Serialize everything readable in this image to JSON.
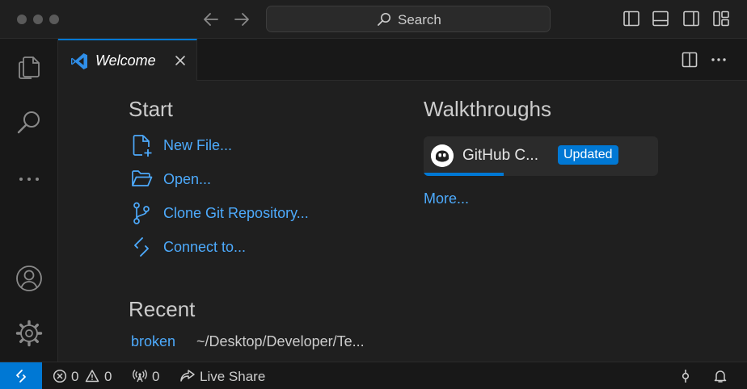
{
  "titlebar": {
    "search_label": "Search"
  },
  "tab": {
    "title": "Welcome"
  },
  "start": {
    "heading": "Start",
    "items": [
      {
        "label": "New File...",
        "icon": "new-file-icon"
      },
      {
        "label": "Open...",
        "icon": "folder-open-icon"
      },
      {
        "label": "Clone Git Repository...",
        "icon": "git-branch-icon"
      },
      {
        "label": "Connect to...",
        "icon": "remote-icon"
      }
    ]
  },
  "walkthroughs": {
    "heading": "Walkthroughs",
    "card_title": "GitHub C...",
    "badge": "Updated",
    "progress": 0.34,
    "more": "More..."
  },
  "recent": {
    "heading": "Recent",
    "items": [
      {
        "name": "broken",
        "path": "~/Desktop/Developer/Te..."
      }
    ]
  },
  "statusbar": {
    "errors": "0",
    "warnings": "0",
    "ports": "0",
    "live_share": "Live Share"
  },
  "colors": {
    "accent": "#0078d4",
    "link": "#4daafc",
    "background": "#1f1f1f"
  }
}
